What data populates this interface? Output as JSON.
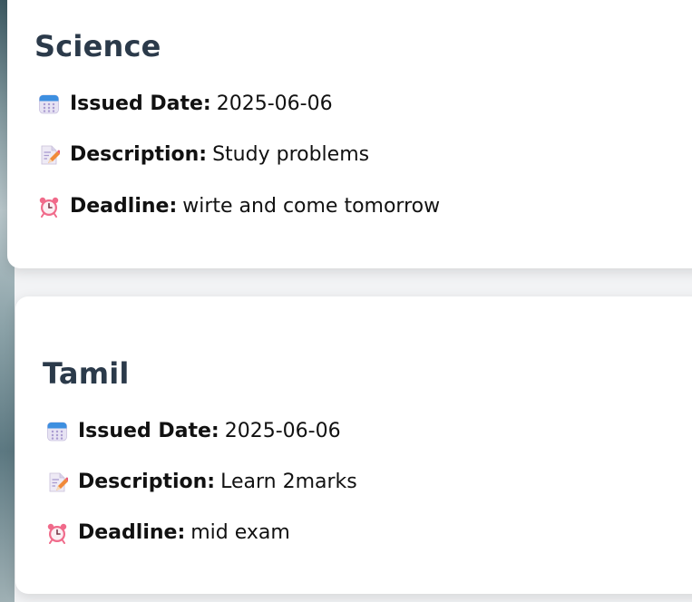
{
  "cards": [
    {
      "subject": "Science",
      "issued_label": "Issued Date:",
      "issued_value": "2025-06-06",
      "description_label": "Description:",
      "description_value": "Study problems",
      "deadline_label": "Deadline:",
      "deadline_value": "wirte and come tomorrow"
    },
    {
      "subject": "Tamil",
      "issued_label": "Issued Date:",
      "issued_value": "2025-06-06",
      "description_label": "Description:",
      "description_value": "Learn 2marks",
      "deadline_label": "Deadline:",
      "deadline_value": "mid exam"
    }
  ],
  "icons": {
    "issued": "calendar-icon",
    "description": "memo-pencil-icon",
    "deadline": "alarm-clock-icon"
  },
  "colors": {
    "title": "#2b3a4a",
    "text": "#111111",
    "card_background": "#ffffff"
  }
}
